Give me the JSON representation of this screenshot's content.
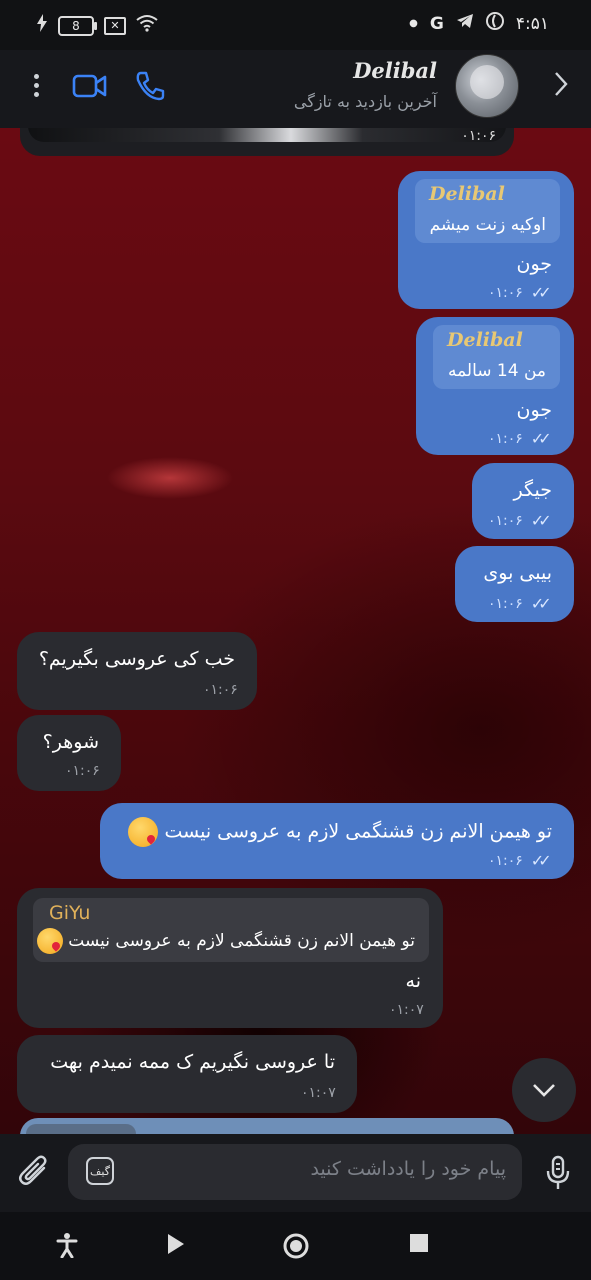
{
  "status": {
    "time": "۴:۵۱",
    "battery": "8",
    "net_letter": "G"
  },
  "header": {
    "title": "Delibal",
    "subtitle": "آخرین بازدید به تازگی"
  },
  "media": {
    "time": "۰۱:۰۶"
  },
  "messages": [
    {
      "reply_name": "Delibal",
      "reply_text": "اوکیه زنت میشم",
      "text": "جون",
      "time": "۰۱:۰۶"
    },
    {
      "reply_name": "Delibal",
      "reply_text": "من 14 سالمه",
      "text": "جون",
      "time": "۰۱:۰۶"
    },
    {
      "text": "جیگر",
      "time": "۰۱:۰۶"
    },
    {
      "text": "بیبی بوی",
      "time": "۰۱:۰۶"
    },
    {
      "text": "خب کی عروسی بگیریم؟",
      "time": "۰۱:۰۶"
    },
    {
      "text": "شوهر؟",
      "time": "۰۱:۰۶"
    },
    {
      "text": "تو هیمن الانم زن قشنگمی لازم به عروسی نیست",
      "time": "۰۱:۰۶"
    },
    {
      "reply_name": "GiYu",
      "reply_text": "تو هیمن الانم زن قشنگمی لازم به عروسی نیست",
      "text": "نه",
      "time": "۰۱:۰۷"
    },
    {
      "text": "تا عروسی نگیریم ک ممه نمیدم بهت",
      "time": "۰۱:۰۷"
    }
  ],
  "input": {
    "placeholder": "پیام خود را یادداشت کنید",
    "gif_label": "گیف"
  },
  "colors": {
    "outgoing": "#4a78c8",
    "incoming": "#2a2b30",
    "accent": "#3b82f6",
    "reply_name": "#e8c874"
  }
}
